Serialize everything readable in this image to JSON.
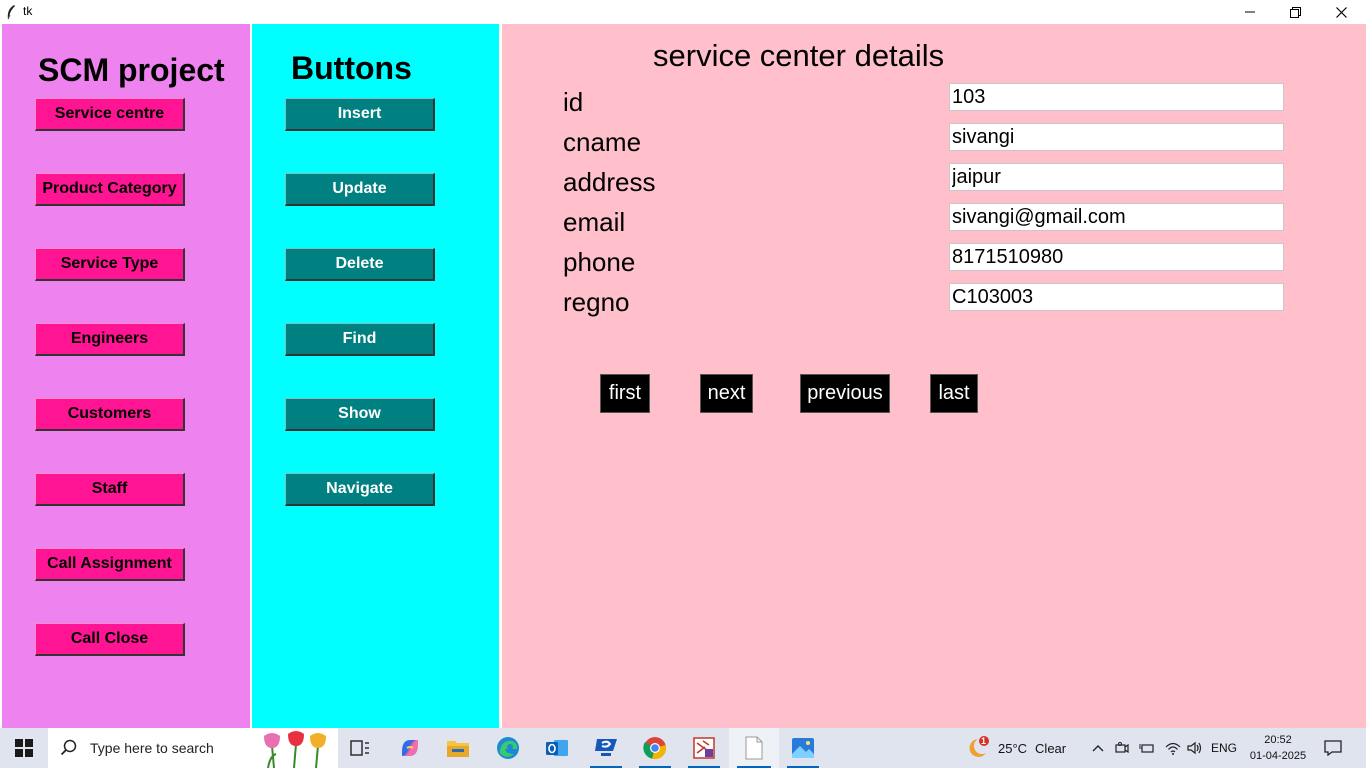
{
  "window": {
    "title": "tk"
  },
  "left_panel": {
    "heading": "SCM project",
    "buttons": [
      "Service centre",
      "Product Category",
      "Service Type",
      "Engineers",
      "Customers",
      "Staff",
      "Call Assignment",
      "Call Close"
    ]
  },
  "middle_panel": {
    "heading": "Buttons",
    "buttons": [
      "Insert",
      "Update",
      "Delete",
      "Find",
      "Show",
      "Navigate"
    ]
  },
  "form": {
    "title": "service center details",
    "fields": [
      {
        "label": "id",
        "value": "103"
      },
      {
        "label": "cname",
        "value": "sivangi"
      },
      {
        "label": "address",
        "value": "jaipur"
      },
      {
        "label": "email",
        "value": "sivangi@gmail.com"
      },
      {
        "label": "phone",
        "value": "8171510980"
      },
      {
        "label": "regno",
        "value": "C103003"
      }
    ],
    "nav_buttons": [
      "first",
      "next",
      "previous",
      "last"
    ]
  },
  "taskbar": {
    "search_placeholder": "Type here to search",
    "weather": {
      "temp": "25°C",
      "condition": "Clear",
      "badge": "1"
    },
    "language": "ENG",
    "time": "20:52",
    "date": "01-04-2025",
    "apps": [
      "task-view-icon",
      "copilot-icon",
      "file-explorer-icon",
      "edge-icon",
      "outlook-icon",
      "remote-app-icon",
      "chrome-icon",
      "scm-app-icon",
      "notepad-icon",
      "photos-icon"
    ]
  },
  "colors": {
    "left_bg": "#ee82ee",
    "middle_bg": "#00ffff",
    "right_bg": "#ffc0cb",
    "pink_button": "#ff1493",
    "teal_button": "#008080",
    "nav_button": "#000000"
  }
}
